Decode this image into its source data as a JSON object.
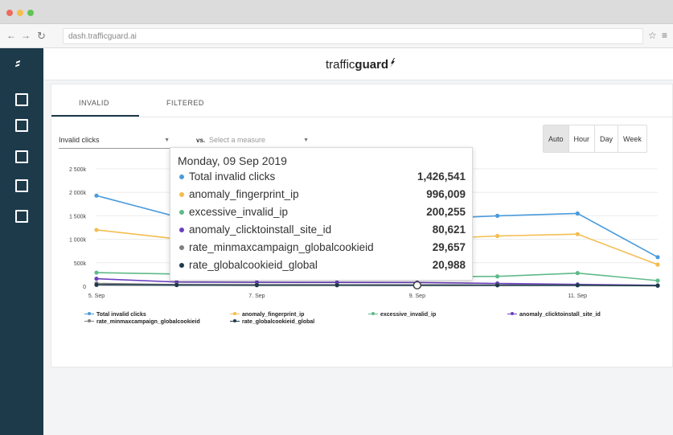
{
  "browser": {
    "url": "dash.trafficguard.ai",
    "traffic_lights": [
      "#ed6a5e",
      "#f5bf4f",
      "#62c554"
    ]
  },
  "app": {
    "brand_prefix": "traffic",
    "brand_bold": "guard",
    "tabs": [
      {
        "label": "INVALID",
        "active": true
      },
      {
        "label": "FILTERED",
        "active": false
      }
    ]
  },
  "controls": {
    "measure_value": "Invalid clicks",
    "vs_label": "vs.",
    "compare_placeholder": "Select a measure",
    "granularity": [
      {
        "label": "Auto",
        "active": true
      },
      {
        "label": "Hour",
        "active": false
      },
      {
        "label": "Day",
        "active": false
      },
      {
        "label": "Week",
        "active": false
      }
    ]
  },
  "tooltip": {
    "title": "Monday, 09 Sep 2019",
    "rows": [
      {
        "name": "Total invalid clicks",
        "value": "1,426,541",
        "color": "#4a9bdc"
      },
      {
        "name": "anomaly_fingerprint_ip",
        "value": "996,009",
        "color": "#f4bd50"
      },
      {
        "name": "excessive_invalid_ip",
        "value": "200,255",
        "color": "#5fba8a"
      },
      {
        "name": "anomaly_clicktoinstall_site_id",
        "value": "80,621",
        "color": "#6a3fbf"
      },
      {
        "name": "rate_minmaxcampaign_globalcookieid",
        "value": "29,657",
        "color": "#7f7f7f"
      },
      {
        "name": "rate_globalcookieid_global",
        "value": "20,988",
        "color": "#1d3a4b"
      }
    ]
  },
  "chart_data": {
    "type": "line",
    "x": [
      "5. Sep",
      "6. Sep",
      "7. Sep",
      "8. Sep",
      "9. Sep",
      "10. Sep",
      "11. Sep",
      "12. Sep"
    ],
    "x_tick_labels": [
      "5. Sep",
      "7. Sep",
      "9. Sep",
      "11. Sep"
    ],
    "y_tick_labels": [
      "0",
      "500k",
      "1 000k",
      "1 500k",
      "2 000k",
      "2 500k"
    ],
    "ylim": [
      0,
      2500000
    ],
    "grid": true,
    "legend_position": "bottom",
    "series": [
      {
        "name": "Total invalid clicks",
        "color": "#4a9bdc",
        "values": [
          1930000,
          1480000,
          1450000,
          1440000,
          1426541,
          1500000,
          1550000,
          620000
        ]
      },
      {
        "name": "anomaly_fingerprint_ip",
        "color": "#f4bd50",
        "values": [
          1200000,
          1010000,
          1000000,
          1000000,
          996009,
          1070000,
          1110000,
          460000
        ]
      },
      {
        "name": "excessive_invalid_ip",
        "color": "#5fba8a",
        "values": [
          290000,
          260000,
          240000,
          220000,
          200255,
          210000,
          280000,
          120000
        ]
      },
      {
        "name": "anomaly_clicktoinstall_site_id",
        "color": "#6a3fbf",
        "values": [
          160000,
          90000,
          85000,
          82000,
          80621,
          60000,
          40000,
          20000
        ]
      },
      {
        "name": "rate_minmaxcampaign_globalcookieid",
        "color": "#7f7f7f",
        "values": [
          60000,
          35000,
          32000,
          30000,
          29657,
          28000,
          25000,
          15000
        ]
      },
      {
        "name": "rate_globalcookieid_global",
        "color": "#1d3a4b",
        "values": [
          30000,
          25000,
          23000,
          22000,
          20988,
          21000,
          20000,
          12000
        ]
      }
    ]
  }
}
